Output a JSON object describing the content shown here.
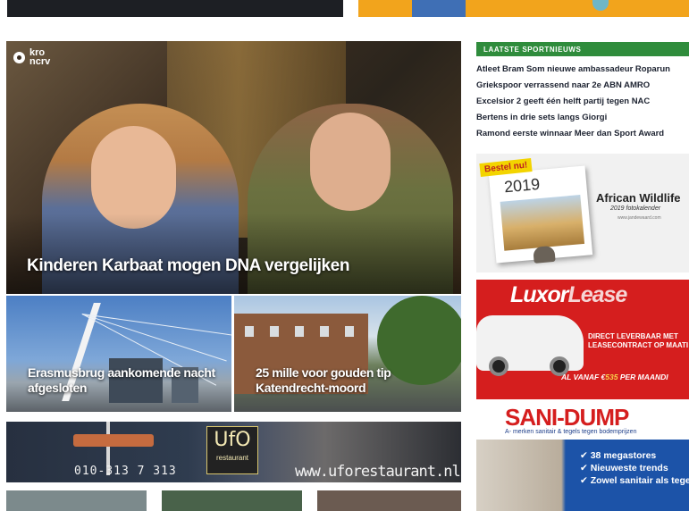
{
  "hero": {
    "logo_line1": "kro",
    "logo_line2": "ncrv",
    "title": "Kinderen Karbaat mogen DNA vergelijken"
  },
  "tiles": [
    {
      "title": "Erasmusbrug aankomende nacht afgesloten"
    },
    {
      "title": "25 mille voor gouden tip Katendrecht-moord"
    }
  ],
  "ufo_banner": {
    "phone": "010-313 7 313",
    "logo_text": "UfO",
    "logo_sub": "restaurant",
    "url": "www.uforestaurant.nl"
  },
  "sports_news": {
    "header": "LAATSTE SPORTNIEUWS",
    "items": [
      "Atleet Bram Som nieuwe ambassadeur Roparun",
      "Griekspoor verrassend naar 2e ABN AMRO",
      "Excelsior 2 geeft één helft partij tegen NAC",
      "Bertens in drie sets langs Giorgi",
      "Ramond eerste winnaar Meer dan Sport Award"
    ]
  },
  "calendar_ad": {
    "badge": "Bestel nu!",
    "year": "2019",
    "title": "African Wildlife",
    "subtitle": "2019 fotokalender",
    "url": "www.jandewaard.com"
  },
  "luxor_ad": {
    "brand_part1": "Luxor",
    "brand_part2": "Lease",
    "line1": "DIRECT LEVERBAAR MET",
    "line2": "LEASECONTRACT OP MAATI",
    "price_prefix": "AL VANAF €",
    "price_value": "535",
    "price_suffix": " PER MAANDI"
  },
  "sani_ad": {
    "brand_part1": "SANI-",
    "brand_part2": "DUMP",
    "tagline": "A- merken sanitair & tegels tegen bodemprijzen",
    "bullets": [
      "38 megastores",
      "Nieuweste trends",
      "Zowel sanitair als tege"
    ]
  }
}
